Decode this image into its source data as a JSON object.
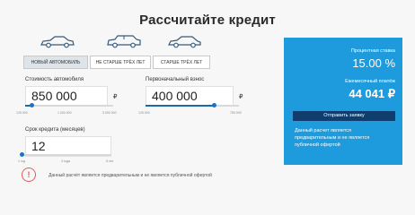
{
  "page": {
    "title": "Рассчитайте кредит"
  },
  "cars": [
    "sedan-icon",
    "crossover-icon",
    "hatchback-icon"
  ],
  "tabs": [
    "НОВЫЙ АВТОМОБИЛЬ",
    "НЕ СТАРШЕ ТРЁХ ЛЕТ",
    "СТАРШЕ ТРЁХ ЛЕТ"
  ],
  "price": {
    "label": "Стоимость автомобиля",
    "value": "850 000",
    "currency": "₽",
    "ticks": [
      "125 000",
      "1 000 000",
      "3 000 000"
    ],
    "fill": 0.07
  },
  "down_payment": {
    "label": "Первоначальный взнос",
    "value": "400 000",
    "currency": "₽",
    "ticks": [
      "125 000",
      "750 000"
    ],
    "fill": 0.73
  },
  "term": {
    "label": "Срок кредита (месяцев)",
    "value": "12",
    "ticks": [
      "1 год",
      "3 года",
      "5 лет"
    ],
    "fill": 0.0
  },
  "panel": {
    "rate_label": "Процентная ставка",
    "rate_value": "15.00 %",
    "payment_label": "Ежемесячный платёж",
    "payment_value": "44 041 ₽",
    "button": "Отправить заявку",
    "note": "Данный расчет является предварительным и не является публичной офертой"
  },
  "disclaimer": {
    "icon": "!",
    "text": "Данный расчёт является предварительным и не является публичной офертой"
  },
  "colors": {
    "panel": "#1e9bdc",
    "button": "#0f3d6e",
    "slider": "#1a6aa8",
    "warning": "#e05a5a"
  }
}
